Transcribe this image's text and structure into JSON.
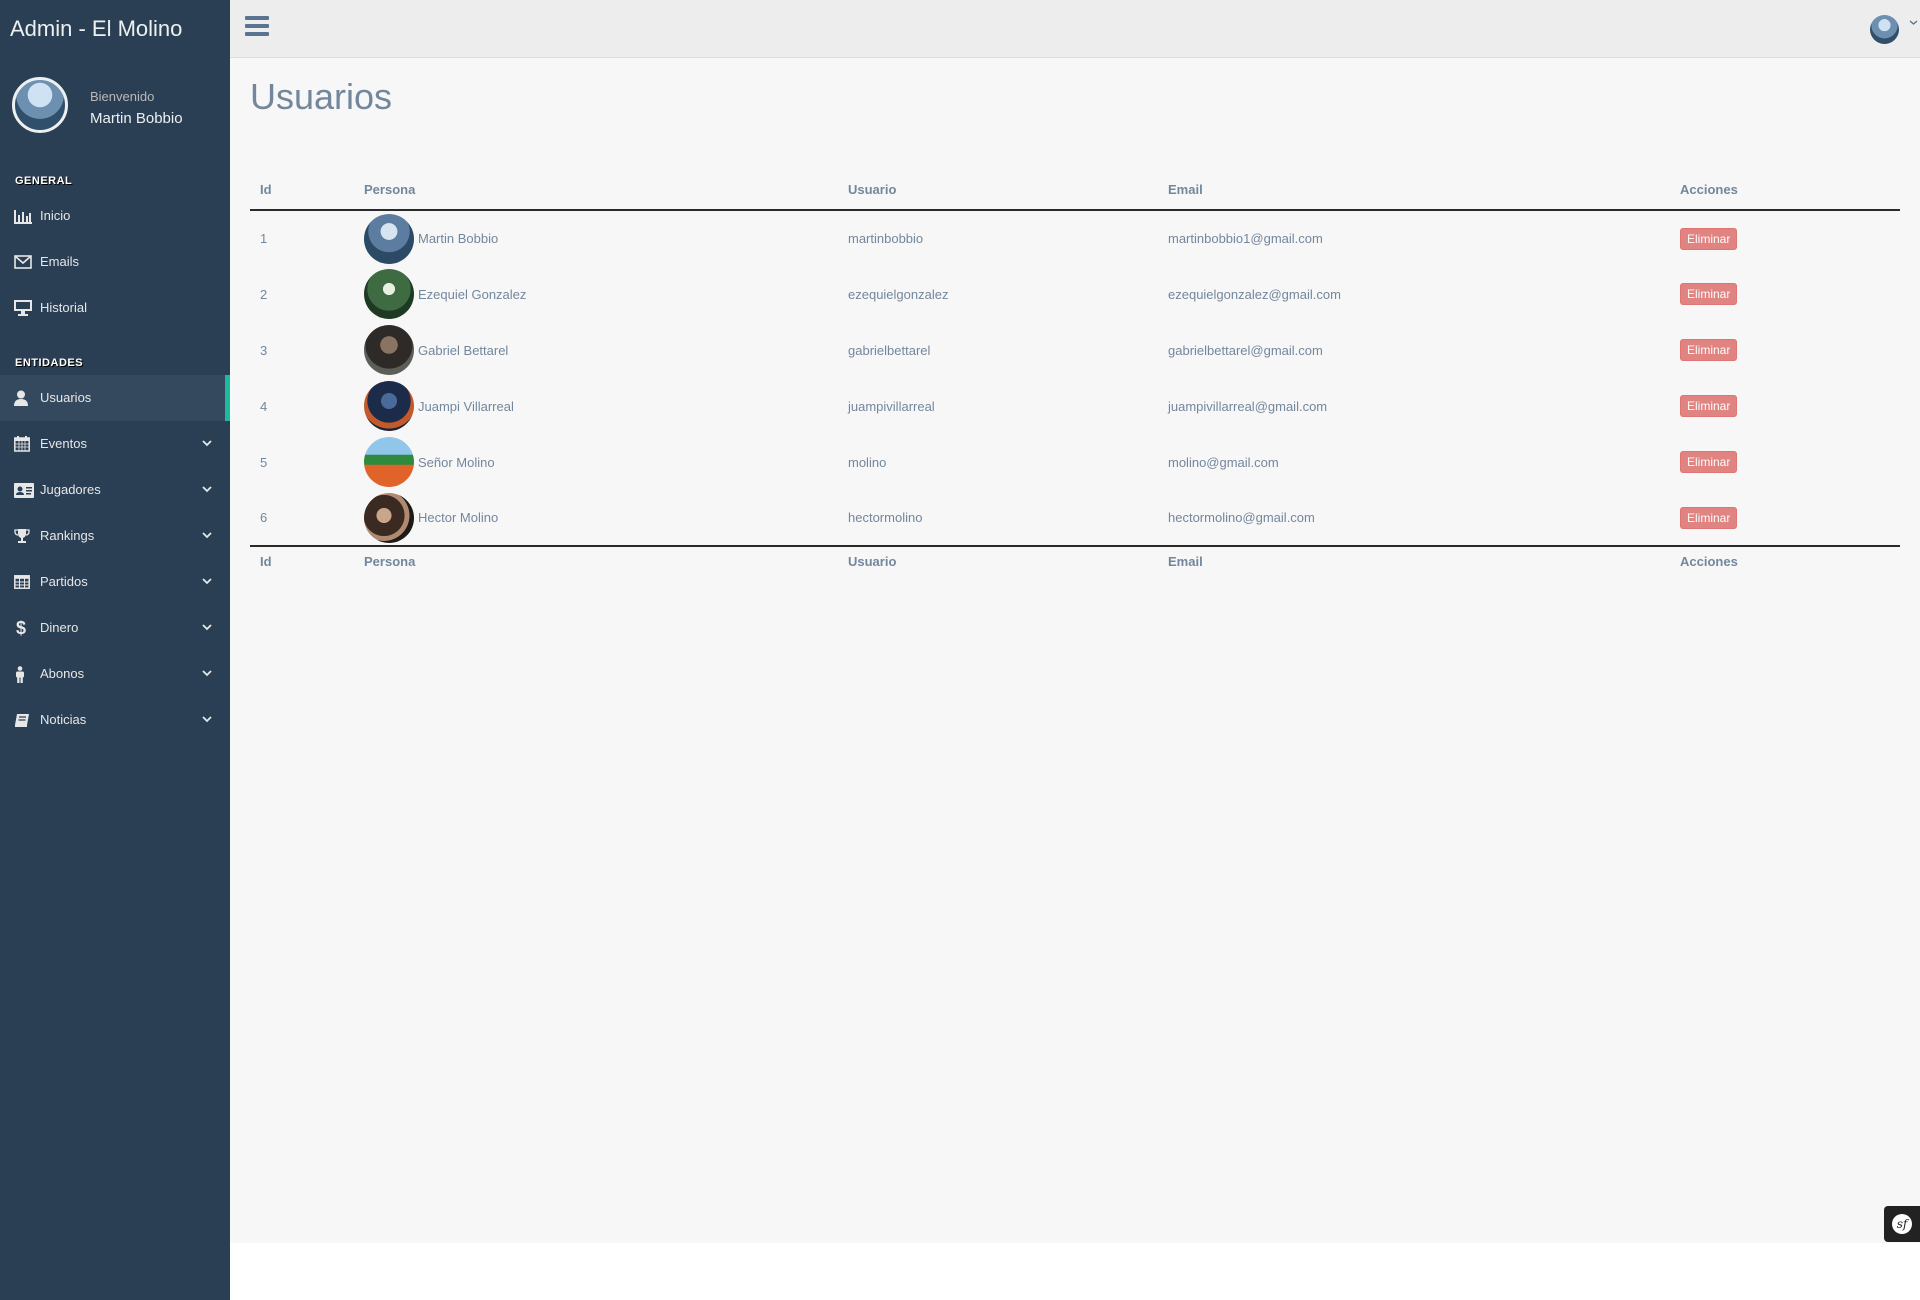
{
  "app": {
    "title": "Admin - El Molino"
  },
  "profile": {
    "welcome": "Bienvenido",
    "name": "Martin Bobbio"
  },
  "sidebar": {
    "general_title": "GENERAL",
    "general_items": [
      {
        "label": "Inicio",
        "icon": "bar-chart-icon"
      },
      {
        "label": "Emails",
        "icon": "envelope-icon"
      },
      {
        "label": "Historial",
        "icon": "desktop-icon"
      }
    ],
    "entidades_title": "ENTIDADES",
    "entidades_items": [
      {
        "label": "Usuarios",
        "icon": "user-icon",
        "active": true
      },
      {
        "label": "Eventos",
        "icon": "calendar-icon"
      },
      {
        "label": "Jugadores",
        "icon": "id-card-icon"
      },
      {
        "label": "Rankings",
        "icon": "trophy-icon"
      },
      {
        "label": "Partidos",
        "icon": "table-icon"
      },
      {
        "label": "Dinero",
        "icon": "dollar-icon"
      },
      {
        "label": "Abonos",
        "icon": "male-icon"
      },
      {
        "label": "Noticias",
        "icon": "book-icon"
      }
    ]
  },
  "page": {
    "title": "Usuarios"
  },
  "table": {
    "columns": [
      "Id",
      "Persona",
      "Usuario",
      "Email",
      "Acciones"
    ],
    "rows": [
      {
        "id": "1",
        "persona": "Martin Bobbio",
        "usuario": "martinbobbio",
        "email": "martinbobbio1@gmail.com",
        "action": "Eliminar"
      },
      {
        "id": "2",
        "persona": "Ezequiel Gonzalez",
        "usuario": "ezequielgonzalez",
        "email": "ezequielgonzalez@gmail.com",
        "action": "Eliminar"
      },
      {
        "id": "3",
        "persona": "Gabriel Bettarel",
        "usuario": "gabrielbettarel",
        "email": "gabrielbettarel@gmail.com",
        "action": "Eliminar"
      },
      {
        "id": "4",
        "persona": "Juampi Villarreal",
        "usuario": "juampivillarreal",
        "email": "juampivillarreal@gmail.com",
        "action": "Eliminar"
      },
      {
        "id": "5",
        "persona": "Señor Molino",
        "usuario": "molino",
        "email": "molino@gmail.com",
        "action": "Eliminar"
      },
      {
        "id": "6",
        "persona": "Hector Molino",
        "usuario": "hectormolino",
        "email": "hectormolino@gmail.com",
        "action": "Eliminar"
      }
    ]
  },
  "colors": {
    "sidebar": "#2a3f54",
    "accent": "#1abb9c",
    "danger": "#d9534f",
    "text": "#73879c"
  }
}
